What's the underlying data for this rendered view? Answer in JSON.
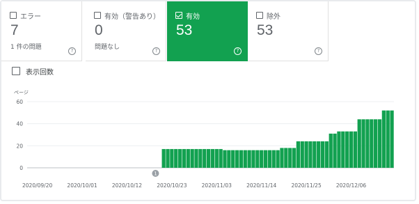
{
  "tiles": [
    {
      "label": "エラー",
      "value": "7",
      "sub": "1 件の問題",
      "selected": false
    },
    {
      "label": "有効（警告あり）",
      "value": "0",
      "sub": "問題なし",
      "selected": false
    },
    {
      "label": "有効",
      "value": "53",
      "sub": "",
      "selected": true
    },
    {
      "label": "除外",
      "value": "53",
      "sub": "",
      "selected": false
    }
  ],
  "impressions_toggle": {
    "label": "表示回数",
    "checked": false
  },
  "colors": {
    "accent": "#12a150",
    "text": "#5f6368",
    "grid": "#e8eaed"
  },
  "chart_data": {
    "type": "bar",
    "ylabel": "ページ",
    "ylim": [
      0,
      60
    ],
    "yticks": [
      0,
      20,
      40,
      60
    ],
    "start_date": "2020-09-18",
    "xtick_labels": [
      "2020/09/20",
      "2020/10/01",
      "2020/10/12",
      "2020/10/23",
      "2020/11/03",
      "2020/11/14",
      "2020/11/25",
      "2020/12/06"
    ],
    "annotation": {
      "label": "1",
      "date": "2020-10-19"
    },
    "values": [
      0,
      0,
      0,
      0,
      0,
      0,
      0,
      0,
      0,
      0,
      0,
      0,
      0,
      0,
      0,
      0,
      0,
      0,
      0,
      0,
      0,
      0,
      0,
      0,
      0,
      0,
      0,
      0,
      0,
      0,
      0,
      0,
      0,
      17,
      17,
      17,
      17,
      17,
      17,
      17,
      17,
      17,
      17,
      17,
      17,
      17,
      17,
      17,
      16,
      16,
      16,
      16,
      16,
      16,
      16,
      16,
      16,
      16,
      16,
      16,
      16,
      16,
      18,
      18,
      18,
      18,
      24,
      24,
      24,
      24,
      24,
      24,
      24,
      24,
      31,
      31,
      33,
      33,
      33,
      33,
      33,
      44,
      44,
      44,
      44,
      44,
      44,
      52,
      52,
      52
    ]
  }
}
